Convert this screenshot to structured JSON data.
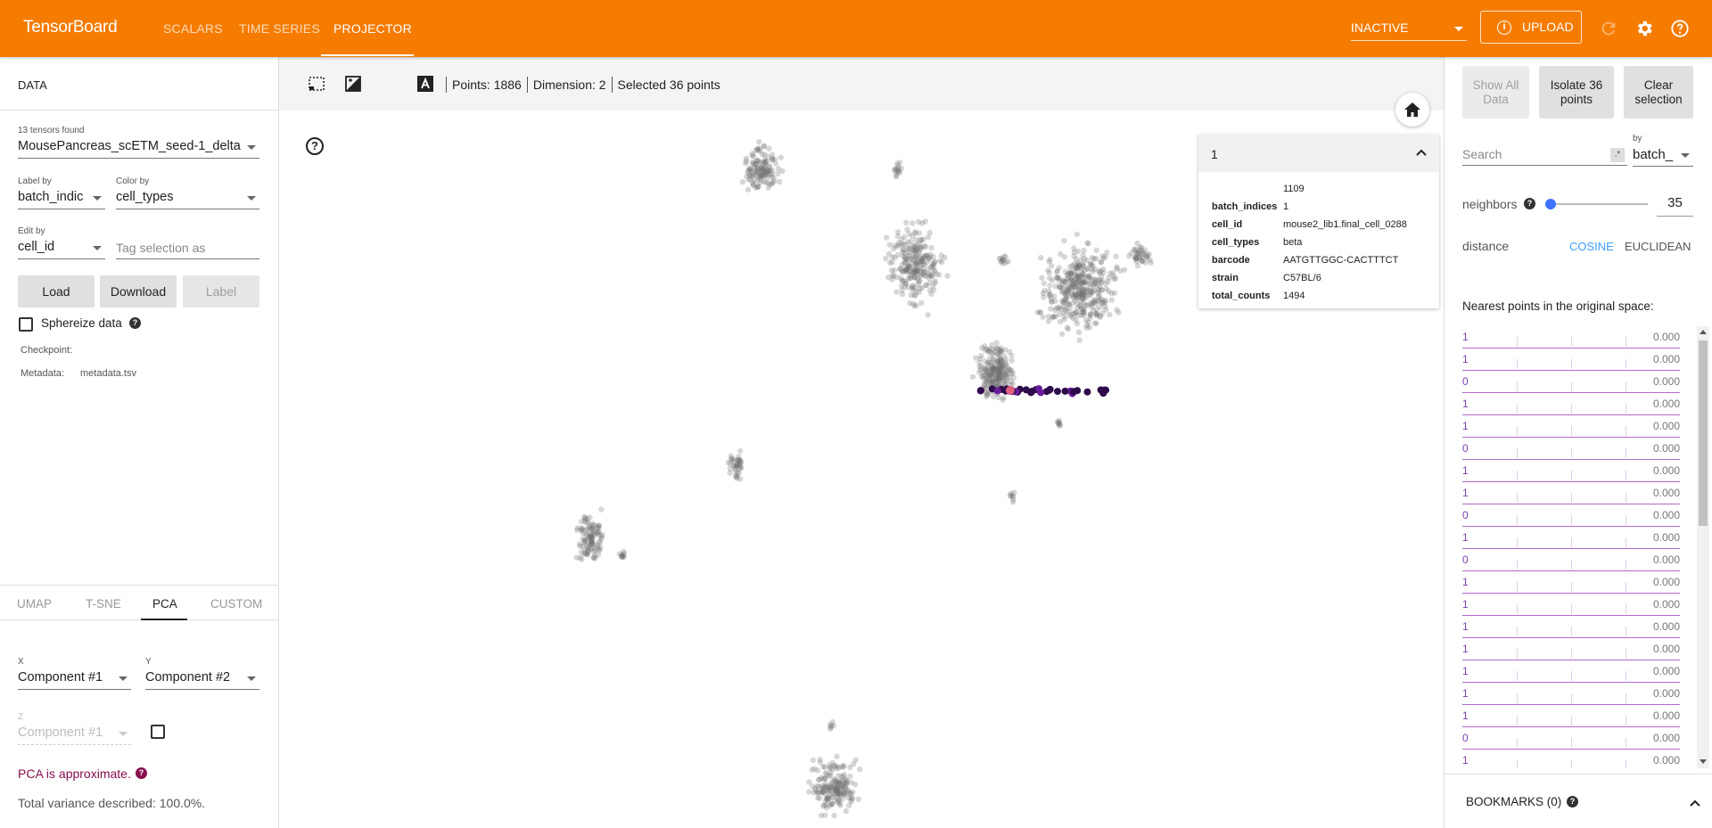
{
  "topbar": {
    "brand": "TensorBoard",
    "tabs": [
      {
        "label": "SCALARS"
      },
      {
        "label": "TIME SERIES"
      },
      {
        "label": "PROJECTOR"
      }
    ],
    "run_status": "INACTIVE",
    "upload_label": "UPLOAD",
    "background_color": "#f57c00"
  },
  "data_panel": {
    "title": "DATA",
    "tensors_found": "13 tensors found",
    "tensor_selected": "MousePancreas_scETM_seed-1_delta",
    "label_by_label": "Label by",
    "label_by_value": "batch_indic",
    "color_by_label": "Color by",
    "color_by_value": "cell_types",
    "edit_by_label": "Edit by",
    "edit_by_value": "cell_id",
    "tag_placeholder": "Tag selection as",
    "load_label": "Load",
    "download_label": "Download",
    "label_button": "Label",
    "sphereize_label": "Sphereize data",
    "checkpoint_label": "Checkpoint:",
    "metadata_label": "Metadata:",
    "metadata_value": "metadata.tsv"
  },
  "projection": {
    "tabs": [
      "UMAP",
      "T-SNE",
      "PCA",
      "CUSTOM"
    ],
    "active_tab": "PCA",
    "x_label": "X",
    "x_value": "Component #1",
    "y_label": "Y",
    "y_value": "Component #2",
    "z_label": "Z",
    "z_value": "Component #1",
    "pca_warning": "PCA is approximate.",
    "variance": "Total variance described: 100.0%."
  },
  "toolbar": {
    "points": "Points: 1886",
    "dimension": "Dimension: 2",
    "selected": "Selected 36 points"
  },
  "inspector": {
    "title": "1",
    "index": "1109",
    "fields": [
      {
        "key": "batch_indices",
        "value": "1"
      },
      {
        "key": "cell_id",
        "value": "mouse2_lib1.final_cell_0288"
      },
      {
        "key": "cell_types",
        "value": "beta"
      },
      {
        "key": "barcode",
        "value": "AATGTTGGC-CACTTTCT"
      },
      {
        "key": "strain",
        "value": "C57BL/6"
      },
      {
        "key": "total_counts",
        "value": "1494"
      }
    ]
  },
  "right_panel": {
    "show_all": "Show All Data",
    "isolate": "Isolate 36 points",
    "clear": "Clear selection",
    "search_placeholder": "Search",
    "regex_glyph": ".*",
    "by_label": "by",
    "by_value": "batch_",
    "neighbors_label": "neighbors",
    "neighbors_value": "35",
    "neighbors_fraction": 0.0,
    "distance_label": "distance",
    "cosine": "COSINE",
    "euclidean": "EUCLIDEAN",
    "nearest_title": "Nearest points in the original space:",
    "nearest": [
      {
        "label": "1",
        "dist": "0.000"
      },
      {
        "label": "1",
        "dist": "0.000"
      },
      {
        "label": "0",
        "dist": "0.000"
      },
      {
        "label": "1",
        "dist": "0.000"
      },
      {
        "label": "1",
        "dist": "0.000"
      },
      {
        "label": "0",
        "dist": "0.000"
      },
      {
        "label": "1",
        "dist": "0.000"
      },
      {
        "label": "1",
        "dist": "0.000"
      },
      {
        "label": "0",
        "dist": "0.000"
      },
      {
        "label": "1",
        "dist": "0.000"
      },
      {
        "label": "0",
        "dist": "0.000"
      },
      {
        "label": "1",
        "dist": "0.000"
      },
      {
        "label": "1",
        "dist": "0.000"
      },
      {
        "label": "1",
        "dist": "0.000"
      },
      {
        "label": "1",
        "dist": "0.000"
      },
      {
        "label": "1",
        "dist": "0.000"
      },
      {
        "label": "1",
        "dist": "0.000"
      },
      {
        "label": "1",
        "dist": "0.000"
      },
      {
        "label": "0",
        "dist": "0.000"
      },
      {
        "label": "1",
        "dist": "0.000"
      }
    ],
    "bookmarks": "BOOKMARKS (0)",
    "accent_color": "#3f73ff",
    "nn_color": "#7b3fb0"
  }
}
